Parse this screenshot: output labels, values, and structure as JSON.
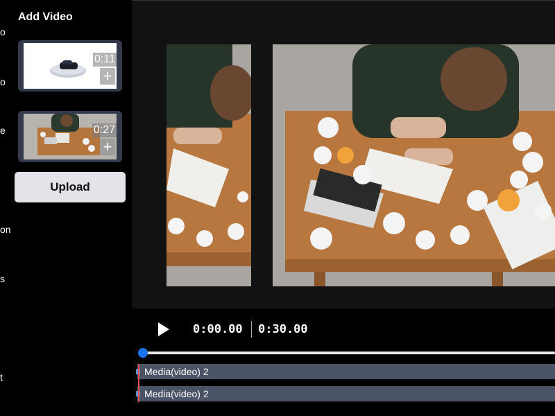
{
  "rail": {
    "labels": [
      "o",
      "o",
      "e",
      "on",
      "s",
      "t"
    ]
  },
  "panel": {
    "title": "Add Video",
    "videos": [
      {
        "duration": "0:11",
        "add_label": "+",
        "thumb": "car-on-turntable"
      },
      {
        "duration": "0:27",
        "add_label": "+",
        "thumb": "man-writing-at-desk"
      }
    ],
    "upload_label": "Upload"
  },
  "player": {
    "current_time": "0:00.00",
    "total_time": "0:30.00",
    "progress": 0
  },
  "timeline": {
    "tracks": [
      {
        "label": "Media(video) 2"
      },
      {
        "label": "Media(video) 2"
      }
    ]
  },
  "colors": {
    "accent": "#1a73e8",
    "track": "#4a5466",
    "playhead": "#e05050",
    "upload_bg": "#e2e4ea"
  }
}
